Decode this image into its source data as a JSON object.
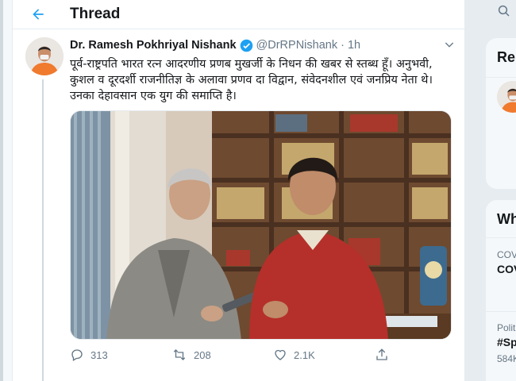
{
  "header": {
    "title": "Thread",
    "back_icon": "arrow-left-icon"
  },
  "tweet": {
    "display_name": "Dr. Ramesh Pokhriyal Nishank",
    "handle": "@DrRPNishank",
    "separator": "·",
    "time": "1h",
    "text": "पूर्व-राष्ट्रपति भारत रत्न आदरणीय प्रणब मुखर्जी के निधन की खबर से स्तब्ध हूँ। अनुभवी, कुशल व दूरदर्शी राजनीतिज्ञ के अलावा प्रणव दा विद्वान, संवेदनशील एवं जनप्रिय नेता थे। उनका देहावसान एक युग की समाप्ति है।",
    "actions": {
      "reply_count": "313",
      "retweet_count": "208",
      "like_count": "2.1K"
    },
    "accent_color": "#1da1f2"
  },
  "right": {
    "card1_title": "Re",
    "card2_title": "Wh",
    "trends": [
      {
        "category": "COV",
        "name": "COV"
      },
      {
        "category": "Polit",
        "name": "#Sp",
        "count": "584K"
      }
    ]
  }
}
